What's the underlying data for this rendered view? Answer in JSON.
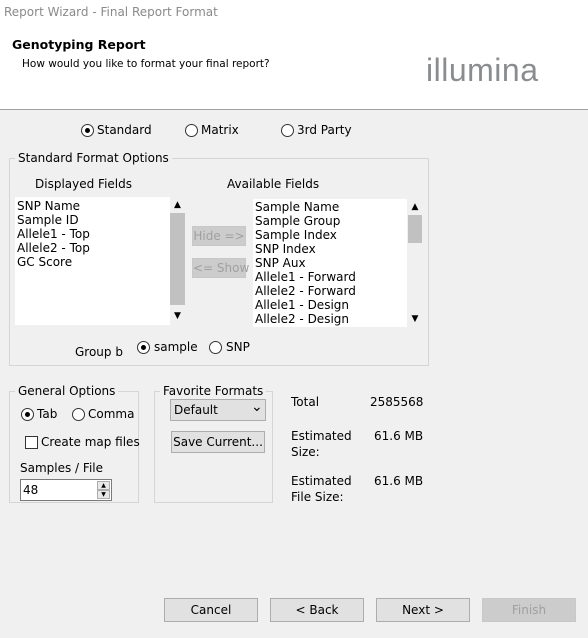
{
  "window": {
    "title": "Report Wizard - Final Report Format"
  },
  "header": {
    "title": "Genotyping Report",
    "subtitle": "How would you like to format your final report?",
    "logo_text": "illumina"
  },
  "format": {
    "options": [
      "Standard",
      "Matrix",
      "3rd Party"
    ],
    "selected": "Standard"
  },
  "standard_options": {
    "title": "Standard Format Options",
    "displayed_label": "Displayed Fields",
    "available_label": "Available Fields",
    "displayed_fields": [
      "SNP Name",
      "Sample ID",
      "Allele1 - Top",
      "Allele2 - Top",
      "GC Score"
    ],
    "available_fields": [
      "Sample Name",
      "Sample Group",
      "Sample Index",
      "SNP Index",
      "SNP Aux",
      "Allele1 - Forward",
      "Allele2 - Forward",
      "Allele1 - Design",
      "Allele2 - Design"
    ],
    "hide_label": "Hide =>",
    "show_label": "<= Show",
    "group_by_label": "Group b",
    "group_by_options": [
      "sample",
      "SNP"
    ],
    "group_by_selected": "sample"
  },
  "general_options": {
    "title": "General Options",
    "delimiters": [
      "Tab",
      "Comma"
    ],
    "delimiter_selected": "Tab",
    "create_map_label": "Create map files",
    "create_map_checked": false,
    "samples_label": "Samples / File",
    "samples_value": "48"
  },
  "favorite_formats": {
    "title": "Favorite Formats",
    "selected": "Default",
    "save_label": "Save Current..."
  },
  "summary": {
    "total_label": "Total",
    "total_value": "2585568",
    "est_size_label_1": "Estimated",
    "est_size_label_2": "Size:",
    "est_size_value": "61.6 MB",
    "est_file_label_1": "Estimated",
    "est_file_label_2": "File Size:",
    "est_file_value": "61.6 MB"
  },
  "footer": {
    "cancel": "Cancel",
    "back": "< Back",
    "next": "Next >",
    "finish": "Finish"
  },
  "icons": {
    "scroll_up": "▲",
    "scroll_down": "▼",
    "dropdown": "⌄"
  }
}
